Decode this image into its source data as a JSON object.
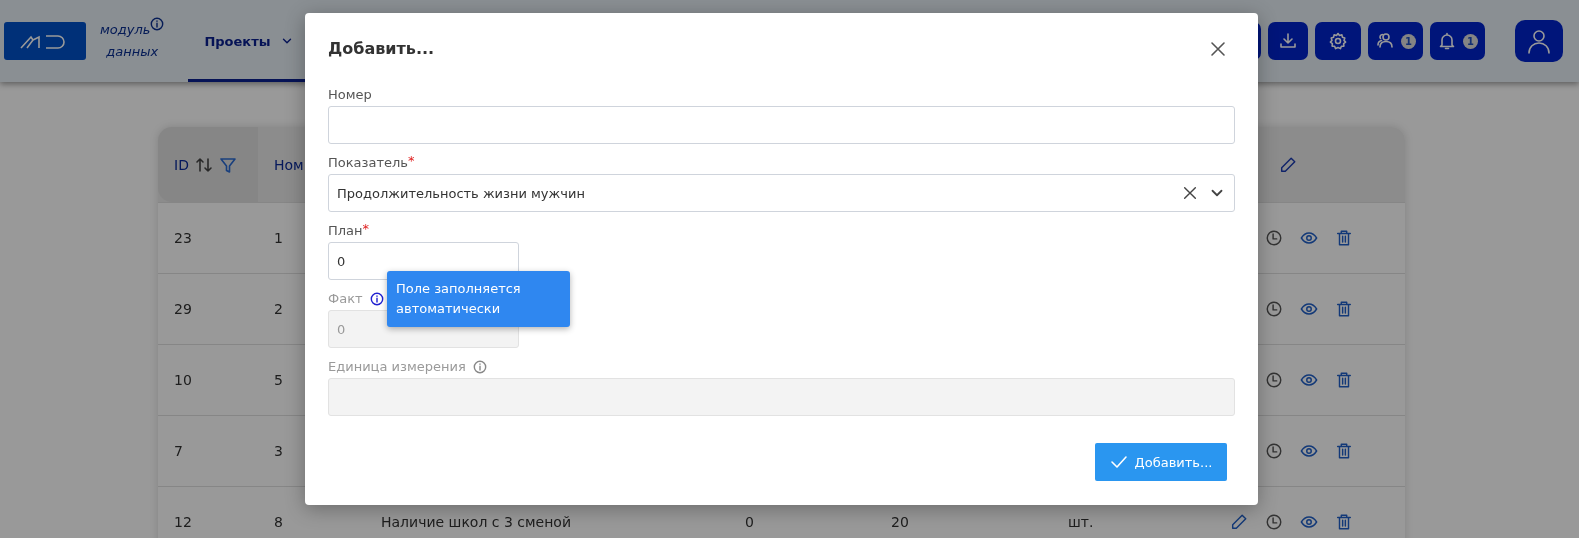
{
  "header": {
    "brand": {
      "line1": "модуль",
      "line2": "данных"
    },
    "nav": [
      {
        "label": "Проекты",
        "selected": true
      }
    ],
    "badges": [
      {
        "kind": "people",
        "count": "1"
      },
      {
        "kind": "bell",
        "count": "1"
      }
    ]
  },
  "table": {
    "columns": [
      {
        "label": "ID",
        "sortable": true,
        "filterable": true
      },
      {
        "label": "Ном"
      }
    ],
    "rows": [
      {
        "id": "23",
        "number": "1"
      },
      {
        "id": "29",
        "number": "2"
      },
      {
        "id": "10",
        "number": "5"
      },
      {
        "id": "7",
        "number": "3"
      },
      {
        "id": "12",
        "number": "8",
        "name": "Наличие школ с 3 сменой",
        "plan": "0",
        "fact": "20",
        "unit": "шт."
      }
    ]
  },
  "dialog": {
    "title": "Добавить...",
    "fields": [
      {
        "kind": "text",
        "label": "Номер",
        "disabled": false
      },
      {
        "kind": "select",
        "label": "Показатель",
        "required_mark": "*",
        "disabled": false,
        "value": "Продолжительность жизни мужчин"
      },
      {
        "kind": "number",
        "label": "План",
        "required_mark": "*",
        "disabled": false,
        "value": "0"
      },
      {
        "kind": "number",
        "label": "Факт",
        "disabled": true,
        "info": true,
        "value": "0"
      },
      {
        "kind": "text",
        "label": "Единица измерения",
        "disabled": true,
        "info": true
      }
    ],
    "submit": "Добавить...",
    "tooltip": "Поле заполняется автоматически"
  }
}
